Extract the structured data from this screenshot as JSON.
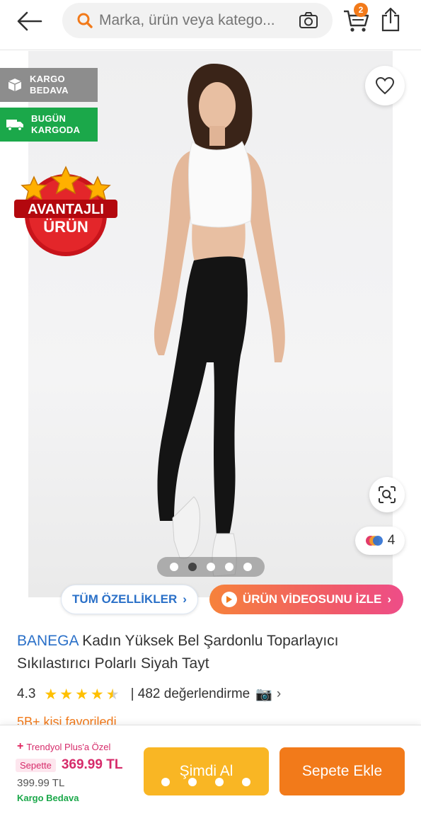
{
  "header": {
    "search_placeholder": "Marka, ürün veya katego...",
    "cart_count": "2"
  },
  "gallery": {
    "badges": {
      "cargo_line1": "KARGO",
      "cargo_line2": "BEDAVA",
      "today_line1": "BUGÜN",
      "today_line2": "KARGODA"
    },
    "advantage_line1": "AVANTAJLI",
    "advantage_line2": "ÜRÜN",
    "color_count": "4",
    "slide_count": 5,
    "active_slide": 2
  },
  "actions": {
    "all_features_label": "TÜM ÖZELLİKLER",
    "video_label": "ÜRÜN VİDEOSUNU İZLE"
  },
  "product": {
    "brand": "BANEGA",
    "name": " Kadın Yüksek Bel Şardonlu Toparlayıcı Sıkılastırıcı Polarlı Siyah Tayt",
    "rating": "4.3",
    "rating_value": 4.3,
    "reviews_text": "| 482 değerlendirme",
    "favorites_peek": "5B+ kişi favoriledi"
  },
  "purchase": {
    "plus_label": "Trendyol Plus'a Özel",
    "cart_tag": "Sepette",
    "cart_price": "369.99 TL",
    "old_price": "399.99 TL",
    "free_shipping": "Kargo Bedava",
    "buy_now_label": "Şimdi Al",
    "add_to_cart_label": "Sepete Ekle"
  },
  "colors": {
    "brand_orange": "#f27a1a",
    "link_blue": "#2a70c8",
    "success_green": "#1ba84a",
    "plus_pink": "#d62b6a",
    "buy_yellow": "#f9b624"
  }
}
